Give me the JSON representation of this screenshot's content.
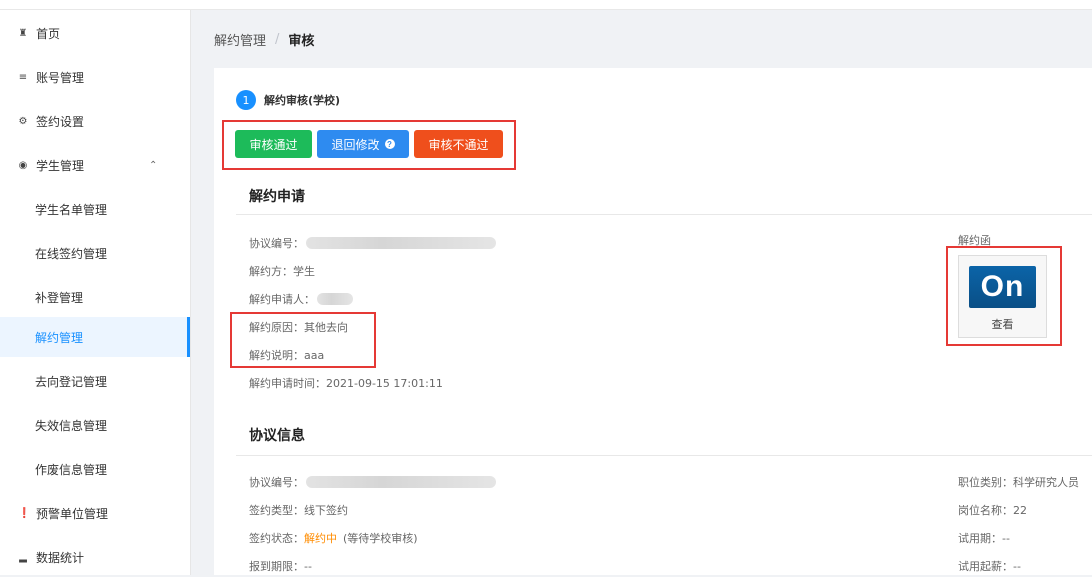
{
  "sidebar": {
    "items": [
      {
        "label": "首页",
        "icon": "home-icon"
      },
      {
        "label": "账号管理",
        "icon": "list-icon"
      },
      {
        "label": "签约设置",
        "icon": "gear-icon"
      },
      {
        "label": "学生管理",
        "icon": "student-icon"
      },
      {
        "label": "学生名单管理"
      },
      {
        "label": "在线签约管理"
      },
      {
        "label": "补登管理"
      },
      {
        "label": "解约管理"
      },
      {
        "label": "去向登记管理"
      },
      {
        "label": "失效信息管理"
      },
      {
        "label": "作废信息管理"
      },
      {
        "label": "预警单位管理",
        "icon": "warning-icon"
      },
      {
        "label": "数据统计",
        "icon": "bar-chart-icon"
      }
    ],
    "active": "解约管理"
  },
  "breadcrumb": {
    "parent": "解约管理",
    "separator": "/",
    "current": "审核"
  },
  "step": {
    "number": "1",
    "label": "解约审核(学校)"
  },
  "actions": {
    "approve": "审核通过",
    "return": "退回修改",
    "reject": "审核不通过"
  },
  "termination": {
    "title": "解约申请",
    "agreement_no_label": "协议编号：",
    "party_label": "解约方：",
    "party_value": "学生",
    "applicant_label": "解约申请人：",
    "reason_label": "解约原因：",
    "reason_value": "其他去向",
    "note_label": "解约说明：",
    "note_value": "aaa",
    "time_label": "解约申请时间：",
    "time_value": "2021-09-15 17:01:11",
    "letter_label": "解约函",
    "letter_logo": "On",
    "letter_view": "查看"
  },
  "agreement": {
    "title": "协议信息",
    "agreement_no_label": "协议编号：",
    "sign_type_label": "签约类型：",
    "sign_type_value": "线下签约",
    "sign_status_label": "签约状态：",
    "sign_status_value": "解约中",
    "sign_status_note": "(等待学校审核)",
    "report_deadline_label": "报到期限：",
    "report_deadline_value": "--",
    "position_category_label": "职位类别：",
    "position_category_value": "科学研究人员",
    "position_name_label": "岗位名称：",
    "position_name_value": "22",
    "probation_label": "试用期：",
    "probation_value": "--",
    "trial_salary_label": "试用起薪：",
    "trial_salary_value": "--"
  },
  "colors": {
    "primary": "#1890ff",
    "approve": "#1dbb5a",
    "return": "#2e8bf0",
    "reject": "#ef4f1c",
    "status_orange": "#ff8c00",
    "highlight_border": "#e53935"
  }
}
